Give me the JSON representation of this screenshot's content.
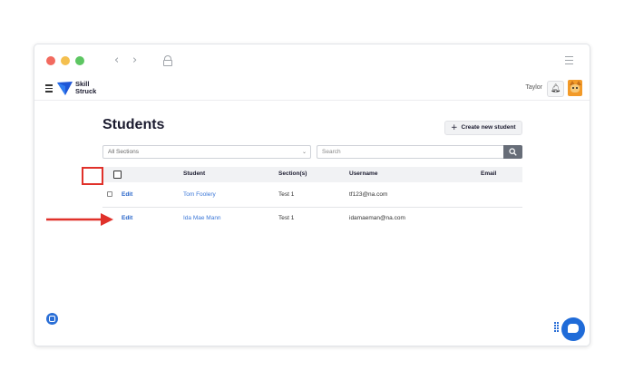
{
  "header": {
    "logo_line1": "Skill",
    "logo_line2": "Struck",
    "username": "Taylor"
  },
  "page": {
    "title": "Students",
    "create_button": "Create new student",
    "section_select": "All Sections",
    "search_placeholder": "Search"
  },
  "table": {
    "columns": [
      "Student",
      "Section(s)",
      "Username",
      "Email"
    ],
    "rows": [
      {
        "action": "Edit",
        "student": "Tom Foolery",
        "section": "Test 1",
        "username": "tf123@na.com",
        "email": ""
      },
      {
        "action": "Edit",
        "student": "Ida Mae Mann",
        "section": "Test 1",
        "username": "idamaeman@na.com",
        "email": ""
      }
    ]
  },
  "colors": {
    "accent": "#2563c9",
    "annotation": "#e0312a"
  },
  "icons": [
    "hamburger-icon",
    "logo-icon",
    "bell-icon",
    "avatar",
    "search-icon",
    "plus-icon",
    "chevron-down-icon",
    "chat-icon",
    "grid-icon",
    "help-icon",
    "lock-icon",
    "settings-icon"
  ]
}
